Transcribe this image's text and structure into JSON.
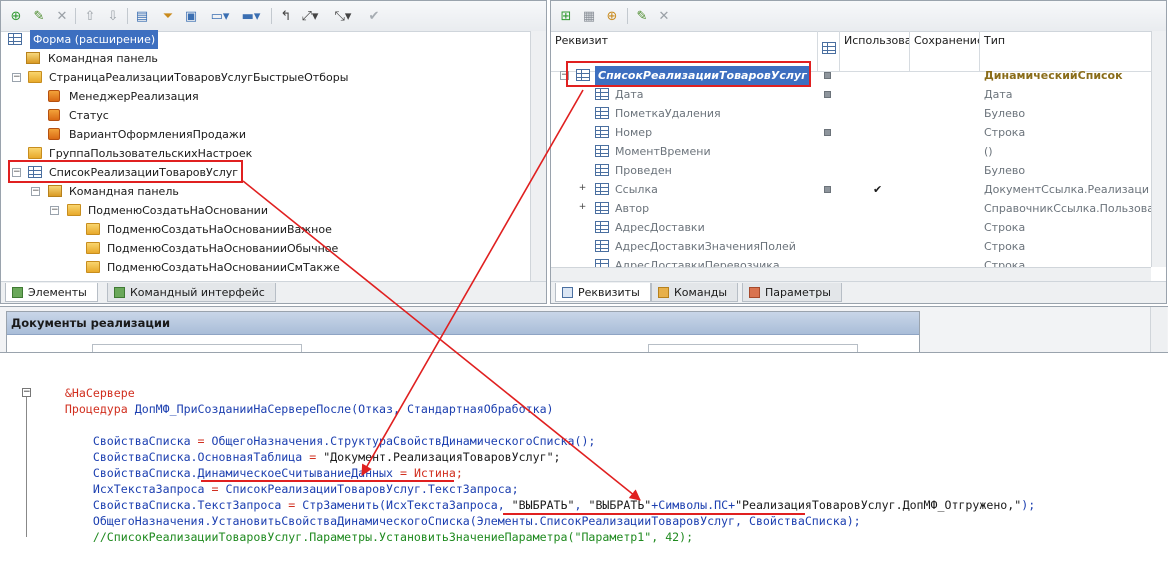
{
  "left_tree": {
    "items": [
      {
        "label": "Форма (расширение)"
      },
      {
        "label": "Командная панель"
      },
      {
        "label": "СтраницаРеализацииТоваровУслугБыстрыеОтборы"
      },
      {
        "label": "МенеджерРеализация"
      },
      {
        "label": "Статус"
      },
      {
        "label": "ВариантОформленияПродажи"
      },
      {
        "label": "ГруппаПользовательскихНастроек"
      },
      {
        "label": "СписокРеализацииТоваровУслуг"
      },
      {
        "label": "Командная панель"
      },
      {
        "label": "ПодменюСоздатьНаОсновании"
      },
      {
        "label": "ПодменюСоздатьНаОснованииВажное"
      },
      {
        "label": "ПодменюСоздатьНаОснованииОбычное"
      },
      {
        "label": "ПодменюСоздатьНаОснованииСмТакже"
      }
    ],
    "tabs": [
      {
        "label": "Элементы"
      },
      {
        "label": "Командный интерфейс"
      }
    ]
  },
  "right_grid": {
    "headers": {
      "name": "Реквизит",
      "use": "Использова",
      "save": "Сохранение",
      "type": "Тип"
    },
    "rows": [
      {
        "name": "СписокРеализацииТоваровУслуг",
        "type": "ДинамическийСписок"
      },
      {
        "name": "Дата",
        "type": "Дата"
      },
      {
        "name": "ПометкаУдаления",
        "type": "Булево"
      },
      {
        "name": "Номер",
        "type": "Строка"
      },
      {
        "name": "МоментВремени",
        "type": "()"
      },
      {
        "name": "Проведен",
        "type": "Булево"
      },
      {
        "name": "Ссылка",
        "type": "ДокументСсылка.Реализаци"
      },
      {
        "name": "Автор",
        "type": "СправочникСсылка.Пользова"
      },
      {
        "name": "АдресДоставки",
        "type": "Строка"
      },
      {
        "name": "АдресДоставкиЗначенияПолей",
        "type": "Строка"
      },
      {
        "name": "АдресДоставкиПеревозчика",
        "type": "Строка"
      }
    ],
    "tabs": [
      {
        "label": "Реквизиты"
      },
      {
        "label": "Команды"
      },
      {
        "label": "Параметры"
      }
    ]
  },
  "preview": {
    "title": "Документы реализации"
  },
  "code": {
    "l1": "&НаСервере",
    "l2_kw": "Процедура",
    "l2_rest": " ДопМФ_ПриСозданииНаСервереПосле(Отказ, СтандартнаяОбработка)",
    "l3a": "    СвойстваСписка ",
    "l3b": "= ",
    "l3c": "ОбщегоНазначения.СтруктураСвойствДинамическогоСписка();",
    "l4a": "    СвойстваСписка.ОсновнаяТаблица ",
    "l4b": "= ",
    "l4c": "\"Документ.РеализацияТоваровУслуг\";",
    "l5a": "    СвойстваСписка.ДинамическоеСчитываниеДанных ",
    "l5b": "= ",
    "l5c": "Истина;",
    "l6a": "    ИсхТекстаЗапроса ",
    "l6b": "= ",
    "l6c": "СписокРеализацииТоваровУслуг.ТекстЗапроса;",
    "l7a": "    СвойстваСписка.ТекстЗапроса ",
    "l7b": "= ",
    "l7c": "СтрЗаменить(ИсхТекстаЗапроса, ",
    "l7d": "\"ВЫБРАТЬ\"",
    "l7e": ", ",
    "l7f": "\"ВЫБРАТЬ\"",
    "l7g": "+Символы.ПС+",
    "l7h": "\"РеализацияТоваровУслуг.ДопМФ_Отгружено,\"",
    "l7i": ");",
    "l8a": "    ОбщегоНазначения.УстановитьСвойстваДинамическогоСписка(",
    "l8b": "Элементы.СписокРеализацииТоваровУслуг",
    "l8c": ", СвойстваСписка);",
    "l9": "    //СписокРеализацииТоваровУслуг.Параметры.УстановитьЗначениеПараметра(\"Параметр1\", 42);"
  },
  "colors": {
    "highlight": "#e02020",
    "keyword": "#d12f1f",
    "identifier": "#1c3fb0",
    "comment": "#1f8a1f"
  }
}
